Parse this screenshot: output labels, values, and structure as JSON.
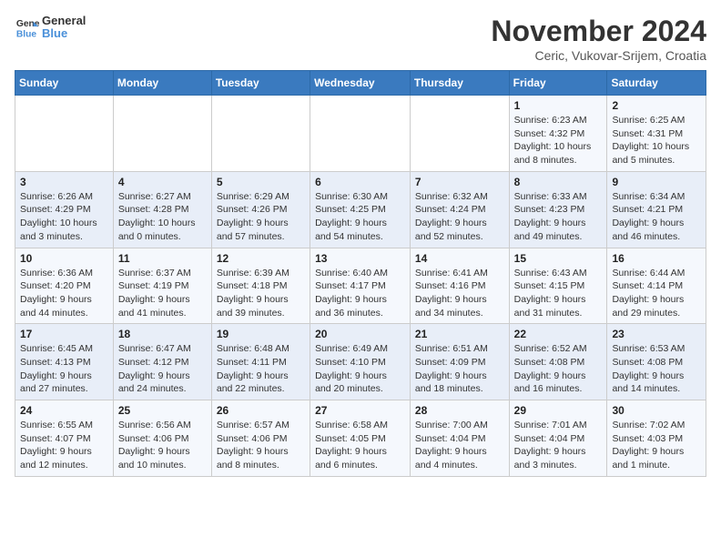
{
  "header": {
    "logo_line1": "General",
    "logo_line2": "Blue",
    "month_title": "November 2024",
    "location": "Ceric, Vukovar-Srijem, Croatia"
  },
  "weekdays": [
    "Sunday",
    "Monday",
    "Tuesday",
    "Wednesday",
    "Thursday",
    "Friday",
    "Saturday"
  ],
  "weeks": [
    [
      {
        "day": "",
        "sunrise": "",
        "sunset": "",
        "daylight": ""
      },
      {
        "day": "",
        "sunrise": "",
        "sunset": "",
        "daylight": ""
      },
      {
        "day": "",
        "sunrise": "",
        "sunset": "",
        "daylight": ""
      },
      {
        "day": "",
        "sunrise": "",
        "sunset": "",
        "daylight": ""
      },
      {
        "day": "",
        "sunrise": "",
        "sunset": "",
        "daylight": ""
      },
      {
        "day": "1",
        "sunrise": "Sunrise: 6:23 AM",
        "sunset": "Sunset: 4:32 PM",
        "daylight": "Daylight: 10 hours and 8 minutes."
      },
      {
        "day": "2",
        "sunrise": "Sunrise: 6:25 AM",
        "sunset": "Sunset: 4:31 PM",
        "daylight": "Daylight: 10 hours and 5 minutes."
      }
    ],
    [
      {
        "day": "3",
        "sunrise": "Sunrise: 6:26 AM",
        "sunset": "Sunset: 4:29 PM",
        "daylight": "Daylight: 10 hours and 3 minutes."
      },
      {
        "day": "4",
        "sunrise": "Sunrise: 6:27 AM",
        "sunset": "Sunset: 4:28 PM",
        "daylight": "Daylight: 10 hours and 0 minutes."
      },
      {
        "day": "5",
        "sunrise": "Sunrise: 6:29 AM",
        "sunset": "Sunset: 4:26 PM",
        "daylight": "Daylight: 9 hours and 57 minutes."
      },
      {
        "day": "6",
        "sunrise": "Sunrise: 6:30 AM",
        "sunset": "Sunset: 4:25 PM",
        "daylight": "Daylight: 9 hours and 54 minutes."
      },
      {
        "day": "7",
        "sunrise": "Sunrise: 6:32 AM",
        "sunset": "Sunset: 4:24 PM",
        "daylight": "Daylight: 9 hours and 52 minutes."
      },
      {
        "day": "8",
        "sunrise": "Sunrise: 6:33 AM",
        "sunset": "Sunset: 4:23 PM",
        "daylight": "Daylight: 9 hours and 49 minutes."
      },
      {
        "day": "9",
        "sunrise": "Sunrise: 6:34 AM",
        "sunset": "Sunset: 4:21 PM",
        "daylight": "Daylight: 9 hours and 46 minutes."
      }
    ],
    [
      {
        "day": "10",
        "sunrise": "Sunrise: 6:36 AM",
        "sunset": "Sunset: 4:20 PM",
        "daylight": "Daylight: 9 hours and 44 minutes."
      },
      {
        "day": "11",
        "sunrise": "Sunrise: 6:37 AM",
        "sunset": "Sunset: 4:19 PM",
        "daylight": "Daylight: 9 hours and 41 minutes."
      },
      {
        "day": "12",
        "sunrise": "Sunrise: 6:39 AM",
        "sunset": "Sunset: 4:18 PM",
        "daylight": "Daylight: 9 hours and 39 minutes."
      },
      {
        "day": "13",
        "sunrise": "Sunrise: 6:40 AM",
        "sunset": "Sunset: 4:17 PM",
        "daylight": "Daylight: 9 hours and 36 minutes."
      },
      {
        "day": "14",
        "sunrise": "Sunrise: 6:41 AM",
        "sunset": "Sunset: 4:16 PM",
        "daylight": "Daylight: 9 hours and 34 minutes."
      },
      {
        "day": "15",
        "sunrise": "Sunrise: 6:43 AM",
        "sunset": "Sunset: 4:15 PM",
        "daylight": "Daylight: 9 hours and 31 minutes."
      },
      {
        "day": "16",
        "sunrise": "Sunrise: 6:44 AM",
        "sunset": "Sunset: 4:14 PM",
        "daylight": "Daylight: 9 hours and 29 minutes."
      }
    ],
    [
      {
        "day": "17",
        "sunrise": "Sunrise: 6:45 AM",
        "sunset": "Sunset: 4:13 PM",
        "daylight": "Daylight: 9 hours and 27 minutes."
      },
      {
        "day": "18",
        "sunrise": "Sunrise: 6:47 AM",
        "sunset": "Sunset: 4:12 PM",
        "daylight": "Daylight: 9 hours and 24 minutes."
      },
      {
        "day": "19",
        "sunrise": "Sunrise: 6:48 AM",
        "sunset": "Sunset: 4:11 PM",
        "daylight": "Daylight: 9 hours and 22 minutes."
      },
      {
        "day": "20",
        "sunrise": "Sunrise: 6:49 AM",
        "sunset": "Sunset: 4:10 PM",
        "daylight": "Daylight: 9 hours and 20 minutes."
      },
      {
        "day": "21",
        "sunrise": "Sunrise: 6:51 AM",
        "sunset": "Sunset: 4:09 PM",
        "daylight": "Daylight: 9 hours and 18 minutes."
      },
      {
        "day": "22",
        "sunrise": "Sunrise: 6:52 AM",
        "sunset": "Sunset: 4:08 PM",
        "daylight": "Daylight: 9 hours and 16 minutes."
      },
      {
        "day": "23",
        "sunrise": "Sunrise: 6:53 AM",
        "sunset": "Sunset: 4:08 PM",
        "daylight": "Daylight: 9 hours and 14 minutes."
      }
    ],
    [
      {
        "day": "24",
        "sunrise": "Sunrise: 6:55 AM",
        "sunset": "Sunset: 4:07 PM",
        "daylight": "Daylight: 9 hours and 12 minutes."
      },
      {
        "day": "25",
        "sunrise": "Sunrise: 6:56 AM",
        "sunset": "Sunset: 4:06 PM",
        "daylight": "Daylight: 9 hours and 10 minutes."
      },
      {
        "day": "26",
        "sunrise": "Sunrise: 6:57 AM",
        "sunset": "Sunset: 4:06 PM",
        "daylight": "Daylight: 9 hours and 8 minutes."
      },
      {
        "day": "27",
        "sunrise": "Sunrise: 6:58 AM",
        "sunset": "Sunset: 4:05 PM",
        "daylight": "Daylight: 9 hours and 6 minutes."
      },
      {
        "day": "28",
        "sunrise": "Sunrise: 7:00 AM",
        "sunset": "Sunset: 4:04 PM",
        "daylight": "Daylight: 9 hours and 4 minutes."
      },
      {
        "day": "29",
        "sunrise": "Sunrise: 7:01 AM",
        "sunset": "Sunset: 4:04 PM",
        "daylight": "Daylight: 9 hours and 3 minutes."
      },
      {
        "day": "30",
        "sunrise": "Sunrise: 7:02 AM",
        "sunset": "Sunset: 4:03 PM",
        "daylight": "Daylight: 9 hours and 1 minute."
      }
    ]
  ]
}
